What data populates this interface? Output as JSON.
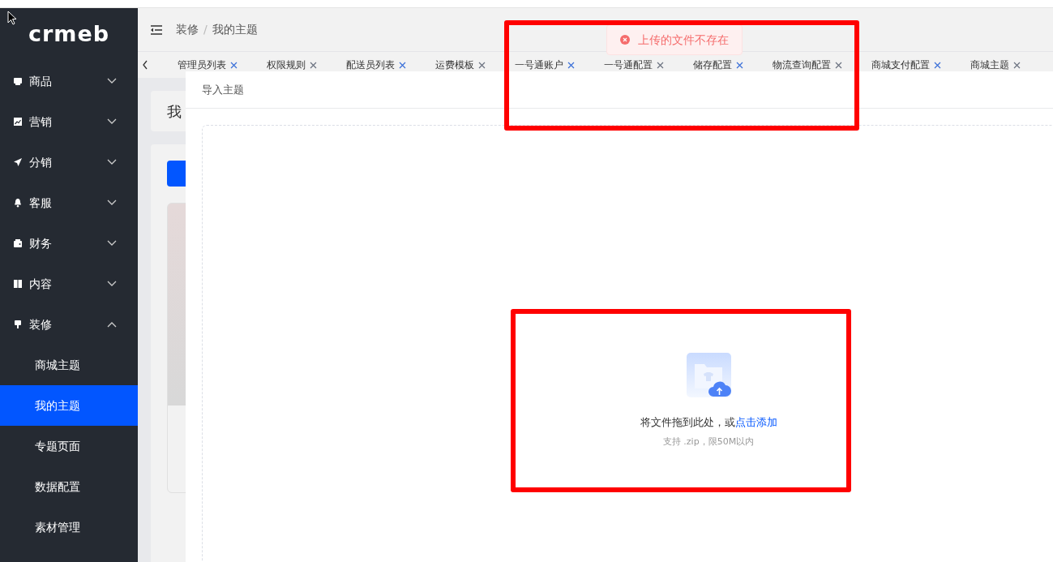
{
  "sidebar": {
    "logo": "crmeb",
    "items": [
      {
        "label": "商品",
        "expanded": false
      },
      {
        "label": "营销",
        "expanded": false
      },
      {
        "label": "分销",
        "expanded": false
      },
      {
        "label": "客服",
        "expanded": false
      },
      {
        "label": "财务",
        "expanded": false
      },
      {
        "label": "内容",
        "expanded": false
      },
      {
        "label": "装修",
        "expanded": true,
        "children": [
          {
            "label": "商城主题",
            "selected": false
          },
          {
            "label": "我的主题",
            "selected": true
          },
          {
            "label": "专题页面",
            "selected": false
          },
          {
            "label": "数据配置",
            "selected": false
          },
          {
            "label": "素材管理",
            "selected": false
          }
        ]
      }
    ]
  },
  "breadcrumb": [
    "装修",
    "我的主题"
  ],
  "breadcrumb_separator": "/",
  "tabs": [
    "管理员列表",
    "权限规则",
    "配送员列表",
    "运费模板",
    "一号通账户",
    "一号通配置",
    "储存配置",
    "物流查询配置",
    "商城支付配置",
    "商城主题"
  ],
  "page": {
    "title": "我"
  },
  "toast": {
    "kind": "error",
    "message": "上传的文件不存在"
  },
  "dialog": {
    "title": "导入主题",
    "upload": {
      "prompt": "将文件拖到此处，或",
      "link": "点击添加",
      "hint": "支持 .zip，限50M以内"
    }
  }
}
